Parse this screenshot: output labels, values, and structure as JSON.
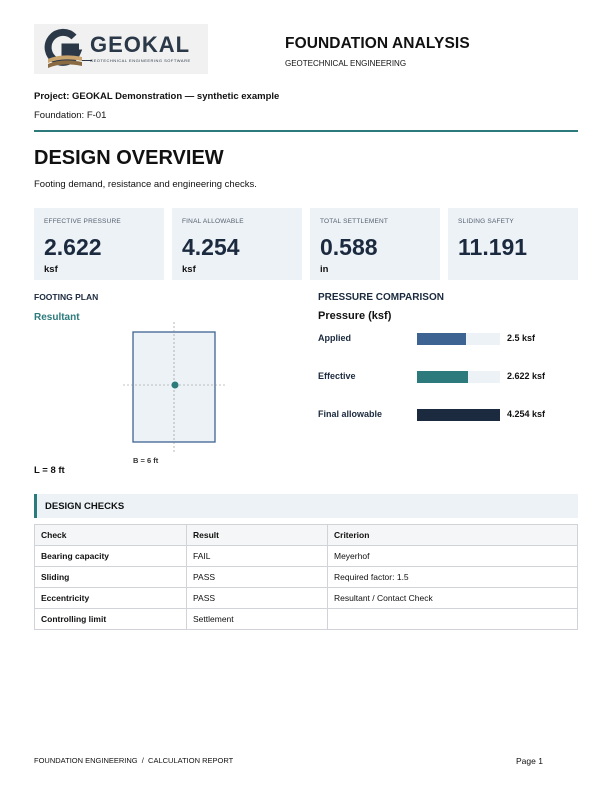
{
  "header": {
    "logo_text": "GEOKAL",
    "logo_tagline": "GEOTECHNICAL ENGINEERING SOFTWARE",
    "title": "FOUNDATION ANALYSIS",
    "subtitle": "GEOTECHNICAL ENGINEERING"
  },
  "project": {
    "project_line": "Project: GEOKAL Demonstration — synthetic example",
    "foundation_line": "Foundation: F-01"
  },
  "overview": {
    "title": "DESIGN OVERVIEW",
    "description": "Footing demand, resistance and engineering checks."
  },
  "cards": [
    {
      "label": "EFFECTIVE PRESSURE",
      "value": "2.622",
      "unit": "ksf"
    },
    {
      "label": "FINAL ALLOWABLE",
      "value": "4.254",
      "unit": "ksf"
    },
    {
      "label": "TOTAL SETTLEMENT",
      "value": "0.588",
      "unit": "in"
    },
    {
      "label": "SLIDING SAFETY",
      "value": "11.191",
      "unit": ""
    }
  ],
  "plan": {
    "heading": "FOOTING PLAN",
    "resultant_label": "Resultant",
    "b_label": "B = 6 ft",
    "l_label": "L = 8 ft"
  },
  "comparison": {
    "heading": "PRESSURE COMPARISON",
    "chart_title": "Pressure (ksf)",
    "bars": [
      {
        "label": "Applied",
        "value": 2.5,
        "value_text": "2.5 ksf",
        "color": "#3d6392"
      },
      {
        "label": "Effective",
        "value": 2.622,
        "value_text": "2.622 ksf",
        "color": "#2c7a7b"
      },
      {
        "label": "Final allowable",
        "value": 4.254,
        "value_text": "4.254 ksf",
        "color": "#1b2a3e"
      }
    ],
    "max_value": 4.254
  },
  "checks": {
    "title": "DESIGN CHECKS",
    "columns": [
      "Check",
      "Result",
      "Criterion"
    ],
    "rows": [
      [
        "Bearing capacity",
        "FAIL",
        "Meyerhof"
      ],
      [
        "Sliding",
        "PASS",
        "Required factor: 1.5"
      ],
      [
        "Eccentricity",
        "PASS",
        "Resultant / Contact Check"
      ],
      [
        "Controlling limit",
        "Settlement",
        ""
      ]
    ]
  },
  "footer": {
    "left": "FOUNDATION ENGINEERING  /  CALCULATION REPORT",
    "page": "Page 1"
  },
  "colors": {
    "accent": "#2c7a7b",
    "navy": "#1b2a3e",
    "card_bg": "#edf2f7"
  }
}
